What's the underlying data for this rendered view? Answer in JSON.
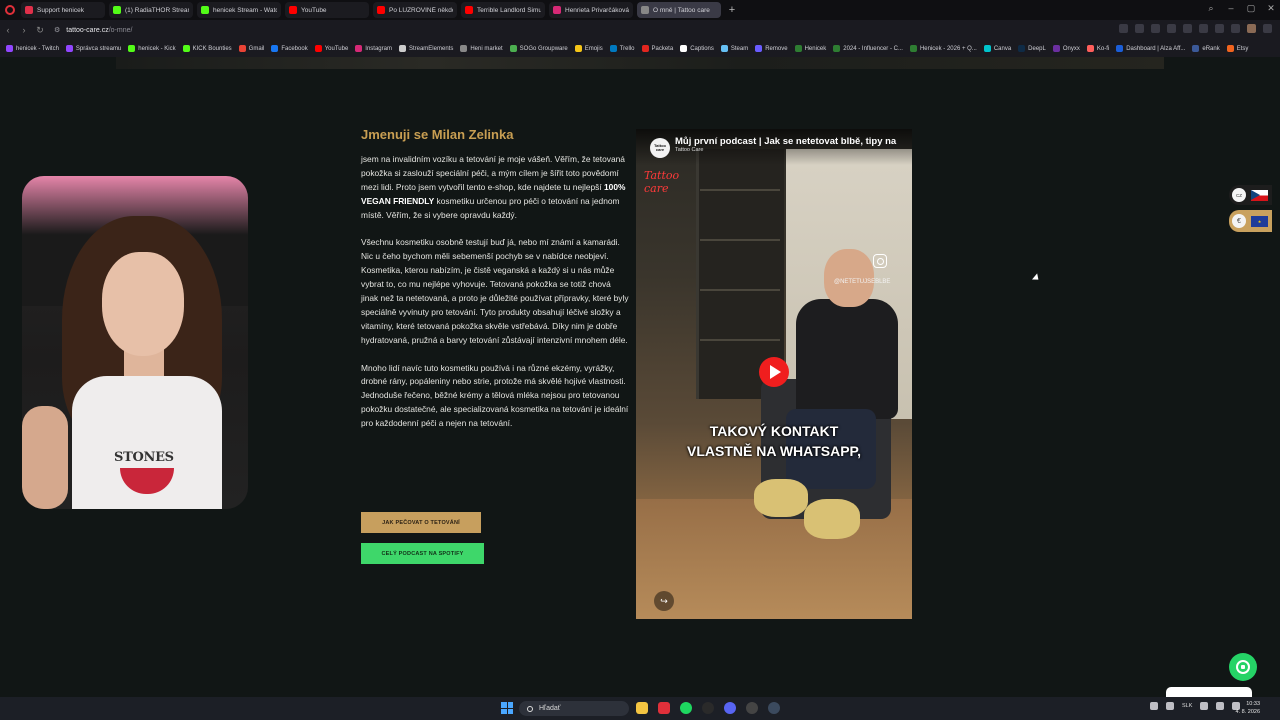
{
  "browser": {
    "tabs": [
      {
        "label": "Support henicek",
        "color": "#e0304a"
      },
      {
        "label": "(1) RadiaTHOR Stream - Y",
        "color": "#53fc18"
      },
      {
        "label": "henicek Stream - Watch L",
        "color": "#53fc18"
      },
      {
        "label": "YouTube",
        "color": "#ff0000"
      },
      {
        "label": "Po LUZROVINĚ někdo ST",
        "color": "#ff0000"
      },
      {
        "label": "Terrible Landlord Simulat",
        "color": "#ff0000"
      },
      {
        "label": "Henrieta Privarčáková (@",
        "color": "#d62976"
      },
      {
        "label": "O mně | Tattoo care",
        "color": "#888888",
        "active": true
      }
    ],
    "new_tab": "+",
    "url_host": "tattoo-care.cz",
    "url_path": "/o-mne/",
    "bookmarks": [
      {
        "label": "henicek - Twitch",
        "color": "#9146ff"
      },
      {
        "label": "Správca streamu",
        "color": "#9146ff"
      },
      {
        "label": "henicek - Kick",
        "color": "#53fc18"
      },
      {
        "label": "KICK Bounties",
        "color": "#53fc18"
      },
      {
        "label": "Gmail",
        "color": "#ea4335"
      },
      {
        "label": "Facebook",
        "color": "#1877f2"
      },
      {
        "label": "YouTube",
        "color": "#ff0000"
      },
      {
        "label": "Instagram",
        "color": "#d62976"
      },
      {
        "label": "StreamElements",
        "color": "#cccccc"
      },
      {
        "label": "Heni market",
        "color": "#888888"
      },
      {
        "label": "SOGo Groupware",
        "color": "#4caf50"
      },
      {
        "label": "Emojis",
        "color": "#f5c518"
      },
      {
        "label": "Trello",
        "color": "#0079bf"
      },
      {
        "label": "Packeta",
        "color": "#e2261f"
      },
      {
        "label": "Captions",
        "color": "#ffffff"
      },
      {
        "label": "Steam",
        "color": "#66c0f4"
      },
      {
        "label": "Remove",
        "color": "#6a5cff"
      },
      {
        "label": "Henicek",
        "color": "#2e7d32"
      },
      {
        "label": "2024 - Influencer - C...",
        "color": "#2e7d32"
      },
      {
        "label": "Henicek - 2026 + Q...",
        "color": "#2e7d32"
      },
      {
        "label": "Canva",
        "color": "#00c4cc"
      },
      {
        "label": "DeepL",
        "color": "#0f2b46"
      },
      {
        "label": "Onyxx",
        "color": "#6b2fa0"
      },
      {
        "label": "Ko-fi",
        "color": "#ff5e5b"
      },
      {
        "label": "Dashboard | Alza Aff...",
        "color": "#1b5ed8"
      },
      {
        "label": "eRank",
        "color": "#3b5998"
      },
      {
        "label": "Etsy",
        "color": "#f1641e"
      }
    ]
  },
  "about": {
    "title": "Jmenuji se Milan Zelinka",
    "p1_before": "jsem na invalidním vozíku a tetování je moje vášeň. Věřím, že tetovaná pokožka si zaslouží speciální péči, a mým cílem je šířit toto povědomí mezi lidi. Proto jsem vytvořil tento e-shop, kde najdete tu nejlepší ",
    "p1_bold": "100% VEGAN FRIENDLY",
    "p1_after": " kosmetiku určenou pro péči o tetování na jednom místě. Věřím, že si vybere opravdu každý.",
    "p2": "Všechnu kosmetiku osobně testují buď já, nebo mí známí a kamarádi. Nic u čeho bychom měli sebemenší pochyb se v nabídce neobjeví. Kosmetika, kterou nabízím, je čistě veganská a každý si u nás může vybrat to, co mu nejlépe vyhovuje. Tetovaná pokožka se totiž chová jinak než ta netetovaná, a proto je důležité používat přípravky, které byly speciálně vyvinuty pro tetování. Tyto produkty obsahují léčivé složky a vitamíny, které tetovaná pokožka skvěle vstřebává. Díky nim je dobře hydratovaná, pružná a barvy tetování zůstávají intenzivní mnohem déle.",
    "p3": "Mnoho lidí navíc tuto kosmetiku používá i na různé ekzémy, vyrážky, drobné rány, popáleniny nebo strie, protože má skvělé hojivé vlastnosti. Jednoduše řečeno, běžné krémy a tělová mléka nejsou pro tetovanou pokožku dostatečné, ale specializovaná kosmetika na tetování je ideální pro každodenní péči a nejen na tetování.",
    "btn_care": "JAK PEČOVAT O TETOVÁNÍ",
    "btn_spotify": "CELÝ PODCAST NA SPOTIFY"
  },
  "video": {
    "title": "Můj první podcast | Jak se netetovat blbě, tipy na",
    "channel": "Tattoo Care",
    "logo_text": "Tattoo care",
    "neon_text": "Tattoo care",
    "handle": "@NETETUJSEBLBE",
    "caption_line1": "TAKOVÝ KONTAKT",
    "caption_line2": "VLASTNĚ NA WHATSAPP,"
  },
  "webcam": {
    "shirt_text": "STONES"
  },
  "widgets": {
    "lang_badge": "CZ",
    "currency_badge": "€"
  },
  "taskbar": {
    "search_placeholder": "Hľadať",
    "lang": "SLK",
    "time": "10:33",
    "date": "4. 8. 2026",
    "apps": [
      {
        "name": "file-explorer",
        "color": "#f4c542"
      },
      {
        "name": "opera-gx",
        "color": "#e0303a"
      },
      {
        "name": "spotify",
        "color": "#1ed760"
      },
      {
        "name": "xbox",
        "color": "#2a2a2a"
      },
      {
        "name": "discord",
        "color": "#5865f2"
      },
      {
        "name": "obs",
        "color": "#444444"
      },
      {
        "name": "steam",
        "color": "#3b4a5e"
      }
    ]
  }
}
